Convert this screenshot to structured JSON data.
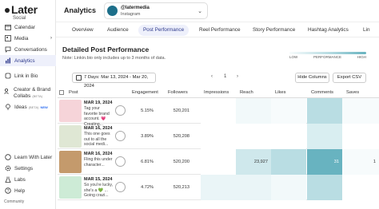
{
  "sidebar": {
    "logo": "Later",
    "logo_sub": "Social",
    "items": [
      {
        "label": "Calendar",
        "icon": "calendar-icon"
      },
      {
        "label": "Media",
        "icon": "media-icon",
        "chevron": "›"
      },
      {
        "label": "Conversations",
        "icon": "chat-icon"
      },
      {
        "label": "Analytics",
        "icon": "analytics-icon",
        "active": true
      },
      {
        "label": "Link in Bio",
        "icon": "link-icon"
      },
      {
        "label": "Creator & Brand Collabs",
        "badge": "(BETA)",
        "icon": "collab-icon"
      },
      {
        "label": "Ideas",
        "badge": "(BETA)",
        "badge2": "NEW",
        "icon": "bulb-icon"
      }
    ],
    "bottom_items": [
      {
        "label": "Learn With Later",
        "icon": "learn-icon"
      },
      {
        "label": "Settings",
        "icon": "gear-icon"
      },
      {
        "label": "Labs",
        "icon": "labs-icon"
      },
      {
        "label": "Help",
        "icon": "help-icon"
      }
    ],
    "community": "Community"
  },
  "header": {
    "title": "Analytics",
    "profile_name": "@latermedia",
    "profile_network": "Instagram"
  },
  "tabs": [
    {
      "label": "Overview"
    },
    {
      "label": "Audience"
    },
    {
      "label": "Post Performance",
      "active": true
    },
    {
      "label": "Reel Performance"
    },
    {
      "label": "Story Performance"
    },
    {
      "label": "Hashtag Analytics"
    },
    {
      "label": "Lin"
    }
  ],
  "content": {
    "title": "Detailed Post Performance",
    "note": "Note: Linkin.bio only includes up to 3 months of data.",
    "legend": {
      "low": "LOW",
      "mid": "PERFORMANCE",
      "high": "HIGH"
    },
    "date_range": "7 Days: Mar 13, 2024 - Mar 20, 2024",
    "page": "1",
    "hide_columns": "Hide Columns",
    "export_csv": "Export CSV"
  },
  "table": {
    "columns": [
      "Post",
      "Engagement",
      "Followers",
      "Impressions",
      "Reach",
      "Likes",
      "Comments",
      "Saves"
    ],
    "rows": [
      {
        "date": "MAR 19, 2024",
        "caption": "Tag your favorite brand account. 💗 Creating...",
        "engagement": "5.15%",
        "followers": "520,201",
        "impressions": "",
        "reach": "",
        "likes": "",
        "comments": "",
        "saves": ""
      },
      {
        "date": "MAR 16, 2024",
        "caption": "This one goes out to all the social medi...",
        "engagement": "3.89%",
        "followers": "520,208",
        "impressions": "",
        "reach": "",
        "likes": "",
        "comments": "",
        "saves": ""
      },
      {
        "date": "MAR 16, 2024",
        "caption": "Fling this under character...",
        "engagement": "6.81%",
        "followers": "520,200",
        "impressions": "",
        "reach": "23,927",
        "likes": "",
        "comments": "31",
        "saves": "1"
      },
      {
        "date": "MAR 15, 2024",
        "caption": "So you're lucky, she's a 💚 ... Going crazi...",
        "engagement": "4.72%",
        "followers": "520,213",
        "impressions": "",
        "reach": "",
        "likes": "",
        "comments": "",
        "saves": ""
      }
    ]
  },
  "colors": {
    "accent": "#2e3a8c",
    "active_bg": "#eef0fb",
    "heat_low": "#f7fbfc",
    "heat_mid": "#b9dde3",
    "heat_high": "#68b3c0"
  }
}
